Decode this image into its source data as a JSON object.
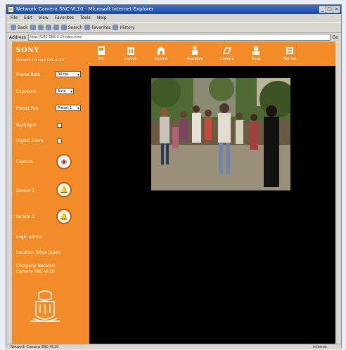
{
  "browser": {
    "title": "Network Camera SNC-VL10 - Microsoft Internet Explorer",
    "menu": [
      "File",
      "Edit",
      "View",
      "Favorites",
      "Tools",
      "Help"
    ],
    "toolbar": [
      "Back",
      "Search",
      "Favorites",
      "History"
    ],
    "address_label": "Address",
    "address_value": "http://192.168.0.1/index.html",
    "go_label": "Go",
    "status_left": "Network Camera SNC-VL10",
    "status_right": "Internet"
  },
  "camera": {
    "logo": "SONY",
    "subtitle": "Network Camera SNC-VL10",
    "frame_rate_label": "Frame Rate",
    "frame_rate_value": "30 fps",
    "exposure_label": "Exposure",
    "exposure_value": "Auto",
    "preset_label": "Preset Pos.",
    "preset_value": "Preset 1",
    "backlight_label": "Backlight",
    "digital_zoom_label": "Digital Zoom",
    "capture_label": "Capture",
    "sensor1_label": "Sensor 1",
    "sensor2_label": "Sensor 2",
    "login_label": "Login admin",
    "location_label": "Location Tokyo Japan",
    "company_label": "Company Network Camera SNC-VL10",
    "nav": [
      {
        "label": "Eth",
        "icon": "setup-icon"
      },
      {
        "label": "Layout",
        "icon": "layout-icon"
      },
      {
        "label": "Control",
        "icon": "control-icon"
      },
      {
        "label": "Available",
        "icon": "available-icon"
      },
      {
        "label": "Camera",
        "icon": "camera-icon"
      },
      {
        "label": "Snap",
        "icon": "snap-icon"
      },
      {
        "label": "Tab Set",
        "icon": "tab-icon"
      }
    ]
  },
  "colors": {
    "accent": "#f28c28",
    "background": "#000000"
  }
}
